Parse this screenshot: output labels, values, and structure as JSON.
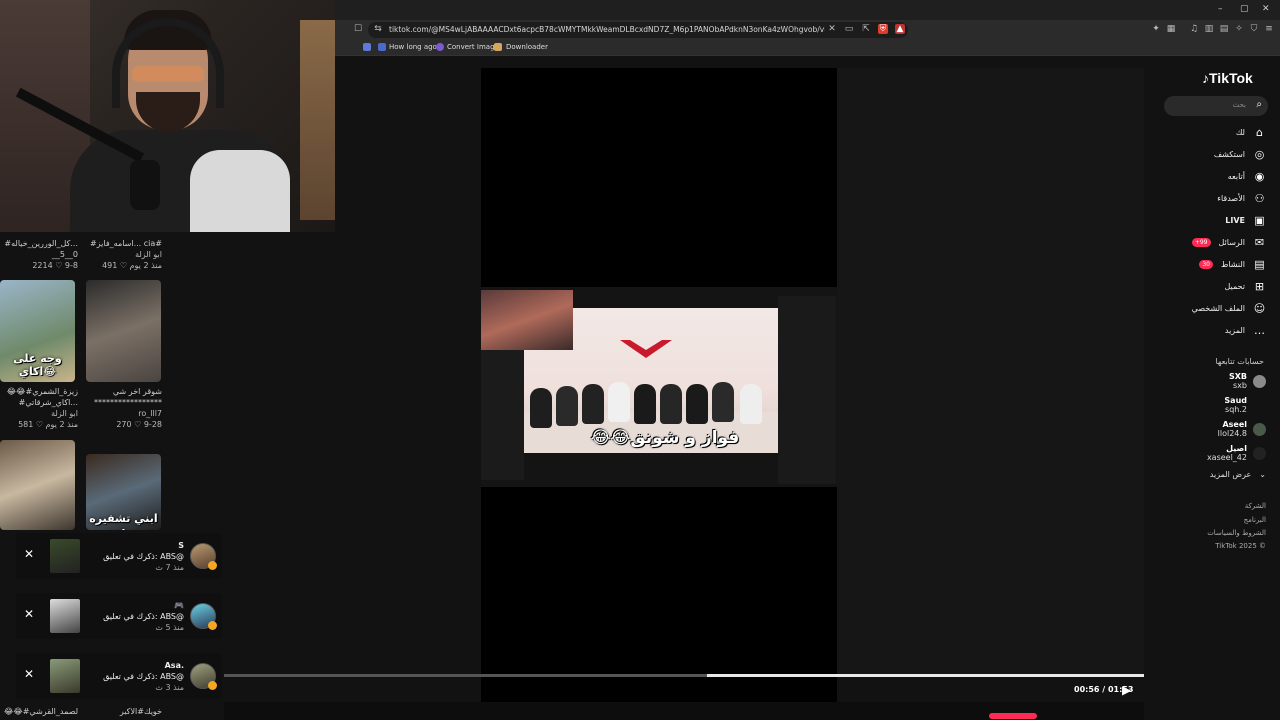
{
  "browser": {
    "url": "tiktok.com/@MS4wLjABAAAACDxt6acpcB78cWMYTMkkWeamDLBcxdND7Z_M6p1PANObAPdknN3onKa4zWOhgvob/video/756227106005...",
    "bookmarks": [
      "How long ago",
      "Convert Image",
      "Downloader"
    ],
    "window_buttons": [
      "–",
      "▢",
      "✕"
    ]
  },
  "tiktok": {
    "logo": "TikTok",
    "search_placeholder": "بحث",
    "nav": [
      {
        "label": "لك",
        "icon": "home-icon",
        "glyph": "⌂"
      },
      {
        "label": "استكشف",
        "icon": "compass-icon",
        "glyph": "◎"
      },
      {
        "label": "أتابعه",
        "icon": "following-avatar-icon",
        "glyph": "◉"
      },
      {
        "label": "الأصدقاء",
        "icon": "friends-icon",
        "glyph": "⚇"
      },
      {
        "label": "LIVE",
        "icon": "live-icon",
        "glyph": "▣"
      },
      {
        "label": "الرسائل",
        "icon": "messages-icon",
        "glyph": "✉",
        "badge": "+99"
      },
      {
        "label": "النشاط",
        "icon": "activity-icon",
        "glyph": "▤",
        "badge": "30"
      },
      {
        "label": "تحميل",
        "icon": "upload-icon",
        "glyph": "⊞"
      },
      {
        "label": "الملف الشخصي",
        "icon": "profile-icon",
        "glyph": "☺"
      },
      {
        "label": "المزيد",
        "icon": "more-icon",
        "glyph": "…"
      }
    ],
    "following_title": "حسابات تتابعها",
    "accounts": [
      {
        "name": "SXB",
        "handle": "sxb"
      },
      {
        "name": "Saud",
        "handle": "sqh.2"
      },
      {
        "name": "Aseel",
        "handle": "llol24.8"
      },
      {
        "name": "اصيل",
        "handle": "xaseel_42"
      }
    ],
    "see_more": "عرض المزيد",
    "footer": [
      "الشركة",
      "البرنامج",
      "الشروط والسياسات",
      "TikTok 2025 ©"
    ]
  },
  "video": {
    "subtitle": "😂😂فواز و شونق",
    "time": "00:56 / 01:53",
    "progress": 0.475
  },
  "feed": {
    "rows": [
      {
        "left": {
          "caption": "#كل_الوررين_خياله...",
          "sub": "__5__0",
          "stats": "2214 ♡  9-8"
        },
        "right": {
          "caption": "#اسامه_فايز... cia#",
          "author": "ابو الزلة",
          "stats": "491 ♡  منذ 2 يوم"
        }
      },
      {
        "left": {
          "overlay": "وجه على اكاي😂",
          "caption": "😂😂#زيزة_الشمري",
          "caption2": "#اكاي_شرقاتي...",
          "author": "ابو الزلة",
          "stats": "581 ♡  منذ 2 يوم"
        },
        "right": {
          "caption": "شوقر اخر شي",
          "caption2": "*****************",
          "author": "ro_lll7",
          "stats": "270 ♡  9-28"
        }
      },
      {
        "left": {
          "caption": ""
        },
        "right": {
          "overlay": "ابني تشفيره :"
        }
      }
    ],
    "bottom_captions": [
      "😂😂#عبدالصمد_القرشي",
      "خويك#الاكبر"
    ]
  },
  "notifications": [
    {
      "title": "S",
      "body": "ذكرك في تعليق: ABS@",
      "time": "منذ 7 ث"
    },
    {
      "title": "🎮",
      "body": "ذكرك في تعليق: ABS@",
      "time": "منذ 5 ث"
    },
    {
      "title": "Asa.",
      "body": "ذكرك في تعليق: ABS@",
      "time": "منذ 3 ث"
    }
  ],
  "colors": {
    "accent": "#fe2c55",
    "bg": "#121212"
  }
}
